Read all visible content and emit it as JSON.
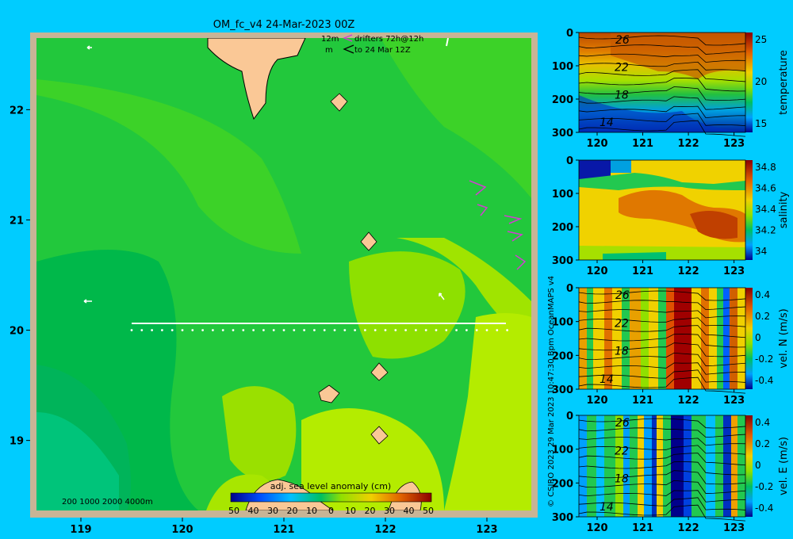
{
  "title": "OM_fc_v4  24-Mar-2023 00Z",
  "drifters": {
    "line1_left": "12m",
    "line1_right": "drifters 72h@12h",
    "line2_left": "m",
    "line2_right": "to 24 Mar 12Z"
  },
  "depth_legend": "200  1000  2000  4000m",
  "credit_side": "© CSIRO 2023   29 Mar 2023 10:47:30 Bpm OceanMAPS v4",
  "chart_data": [
    {
      "type": "heatmap",
      "panel": "map",
      "x_ticks": [
        "119",
        "120",
        "121",
        "122",
        "123"
      ],
      "y_ticks": [
        "22",
        "21",
        "20",
        "19"
      ],
      "xlim": [
        118.5,
        123.5
      ],
      "ylim": [
        18.3,
        22.7
      ],
      "colorbar": {
        "label": "adj. sea level anomaly (cm)",
        "ticks": [
          "50",
          "40",
          "30",
          "20",
          "10",
          "0",
          "10",
          "20",
          "30",
          "40",
          "50"
        ],
        "range": [
          -50,
          50
        ]
      },
      "section_line": {
        "lat": 20.0,
        "lon_start": 119.5,
        "lon_end": 123.2
      },
      "colors": {
        "frame": "#c8b496",
        "land": "#fac896"
      }
    },
    {
      "type": "heatmap",
      "panel": "temperature",
      "colorbar_label": "temperature",
      "colorbar_ticks": [
        "25",
        "20",
        "15"
      ],
      "x_ticks": [
        "120",
        "121",
        "122",
        "123"
      ],
      "y_ticks": [
        "0",
        "100",
        "200",
        "300"
      ],
      "contour_labels": [
        "26",
        "22",
        "18",
        "14"
      ]
    },
    {
      "type": "heatmap",
      "panel": "salinity",
      "colorbar_label": "salinity",
      "colorbar_ticks": [
        "34.8",
        "34.6",
        "34.4",
        "34.2",
        "34"
      ],
      "x_ticks": [
        "120",
        "121",
        "122",
        "123"
      ],
      "y_ticks": [
        "0",
        "100",
        "200",
        "300"
      ]
    },
    {
      "type": "heatmap",
      "panel": "vel_N",
      "colorbar_label": "vel. N (m/s)",
      "colorbar_ticks": [
        "0.4",
        "0.2",
        "0",
        "-0.2",
        "-0.4"
      ],
      "x_ticks": [
        "120",
        "121",
        "122",
        "123"
      ],
      "y_ticks": [
        "0",
        "100",
        "200",
        "300"
      ],
      "contour_labels": [
        "26",
        "22",
        "18",
        "14"
      ]
    },
    {
      "type": "heatmap",
      "panel": "vel_E",
      "colorbar_label": "vel. E (m/s)",
      "colorbar_ticks": [
        "0.4",
        "0.2",
        "0",
        "-0.2",
        "-0.4"
      ],
      "x_ticks": [
        "120",
        "121",
        "122",
        "123"
      ],
      "y_ticks": [
        "0",
        "100",
        "200",
        "300"
      ],
      "contour_labels": [
        "26",
        "22",
        "18",
        "14"
      ]
    }
  ]
}
